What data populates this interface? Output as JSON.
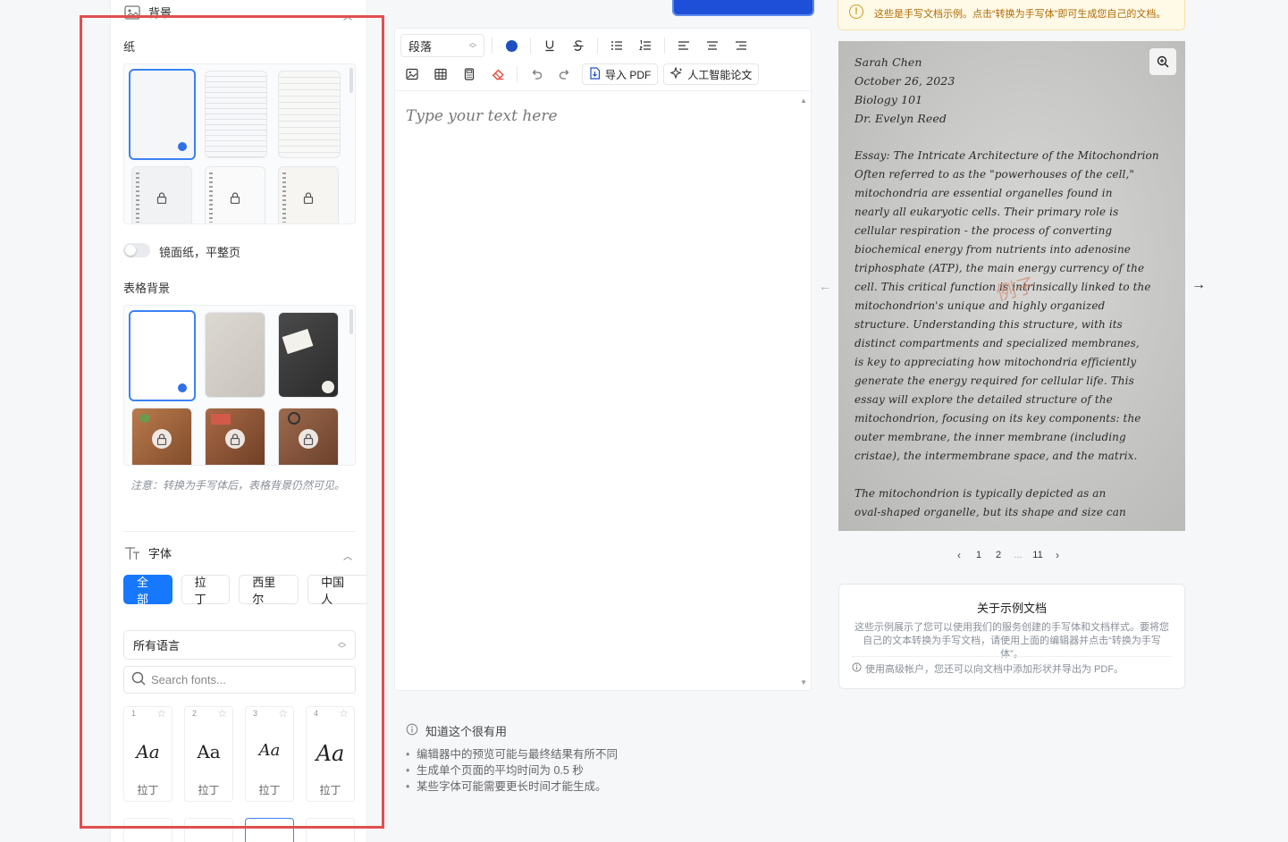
{
  "left": {
    "background_section": "背景",
    "paper_label": "纸",
    "mirror_toggle_label": "镜面纸，平整页",
    "table_bg_label": "表格背景",
    "note": "注意：转换为手写体后，表格背景仍然可见。",
    "font_section": "字体",
    "chips": [
      "全部",
      "拉丁",
      "西里尔",
      "中国人"
    ],
    "language_select": "所有语言",
    "search_placeholder": "Search fonts...",
    "font_cards": [
      {
        "num": "1",
        "sample": "Aa",
        "lang": "拉丁"
      },
      {
        "num": "2",
        "sample": "Aa",
        "lang": "拉丁"
      },
      {
        "num": "3",
        "sample": "Aa",
        "lang": "拉丁"
      },
      {
        "num": "4",
        "sample": "Aa",
        "lang": "拉丁"
      }
    ]
  },
  "top": {
    "notice": "这些是手写文档示例。点击“转换为手写体”即可生成您自己的文档。"
  },
  "editor": {
    "paragraph_select": "段落",
    "import_pdf": "导入 PDF",
    "ai_paper": "人工智能论文",
    "placeholder": "Type your text here"
  },
  "tips": {
    "title": "知道这个很有用",
    "items": [
      "编辑器中的预览可能与最终结果有所不同",
      "生成单个页面的平均时间为 0.5 秒",
      "某些字体可能需要更长时间才能生成。"
    ]
  },
  "preview": {
    "lines": [
      "Sarah Chen",
      "October 26, 2023",
      "Biology 101",
      "Dr. Evelyn Reed",
      "Essay: The Intricate Architecture of the Mitochondrion",
      "Often referred to as the \"powerhouses of the cell,\"",
      "mitochondria are essential organelles found in",
      "nearly all eukaryotic cells. Their primary role is",
      "cellular respiration - the process of converting",
      "biochemical energy from nutrients into adenosine",
      "triphosphate (ATP), the main energy currency of the",
      "cell. This critical function is intrinsically linked to the",
      "mitochondrion's unique and highly organized",
      "structure. Understanding this structure, with its",
      "distinct compartments and specialized membranes,",
      "is key to appreciating how mitochondria efficiently",
      "generate the energy required for cellular life. This",
      "essay will explore the detailed structure of the",
      "mitochondrion, focusing on its key components: the",
      "outer membrane, the inner membrane (including",
      "cristae), the intermembrane space, and the matrix.",
      "The mitochondrion is typically depicted as an",
      "oval-shaped organelle, but its shape and size can"
    ],
    "watermark": "例子"
  },
  "pager": {
    "p1": "1",
    "p2": "2",
    "ellipsis": "...",
    "last": "11"
  },
  "about": {
    "title": "关于示例文档",
    "desc": "这些示例展示了您可以使用我们的服务创建的手写体和文档样式。要将您自己的文本转换为手写文档，请使用上面的编辑器并点击“转换为手写体”。",
    "foot": "使用高级帐户，您还可以向文档中添加形状并导出为 PDF。"
  },
  "colors": {
    "accent": "#1677ff",
    "highlight": "#e0504e"
  }
}
